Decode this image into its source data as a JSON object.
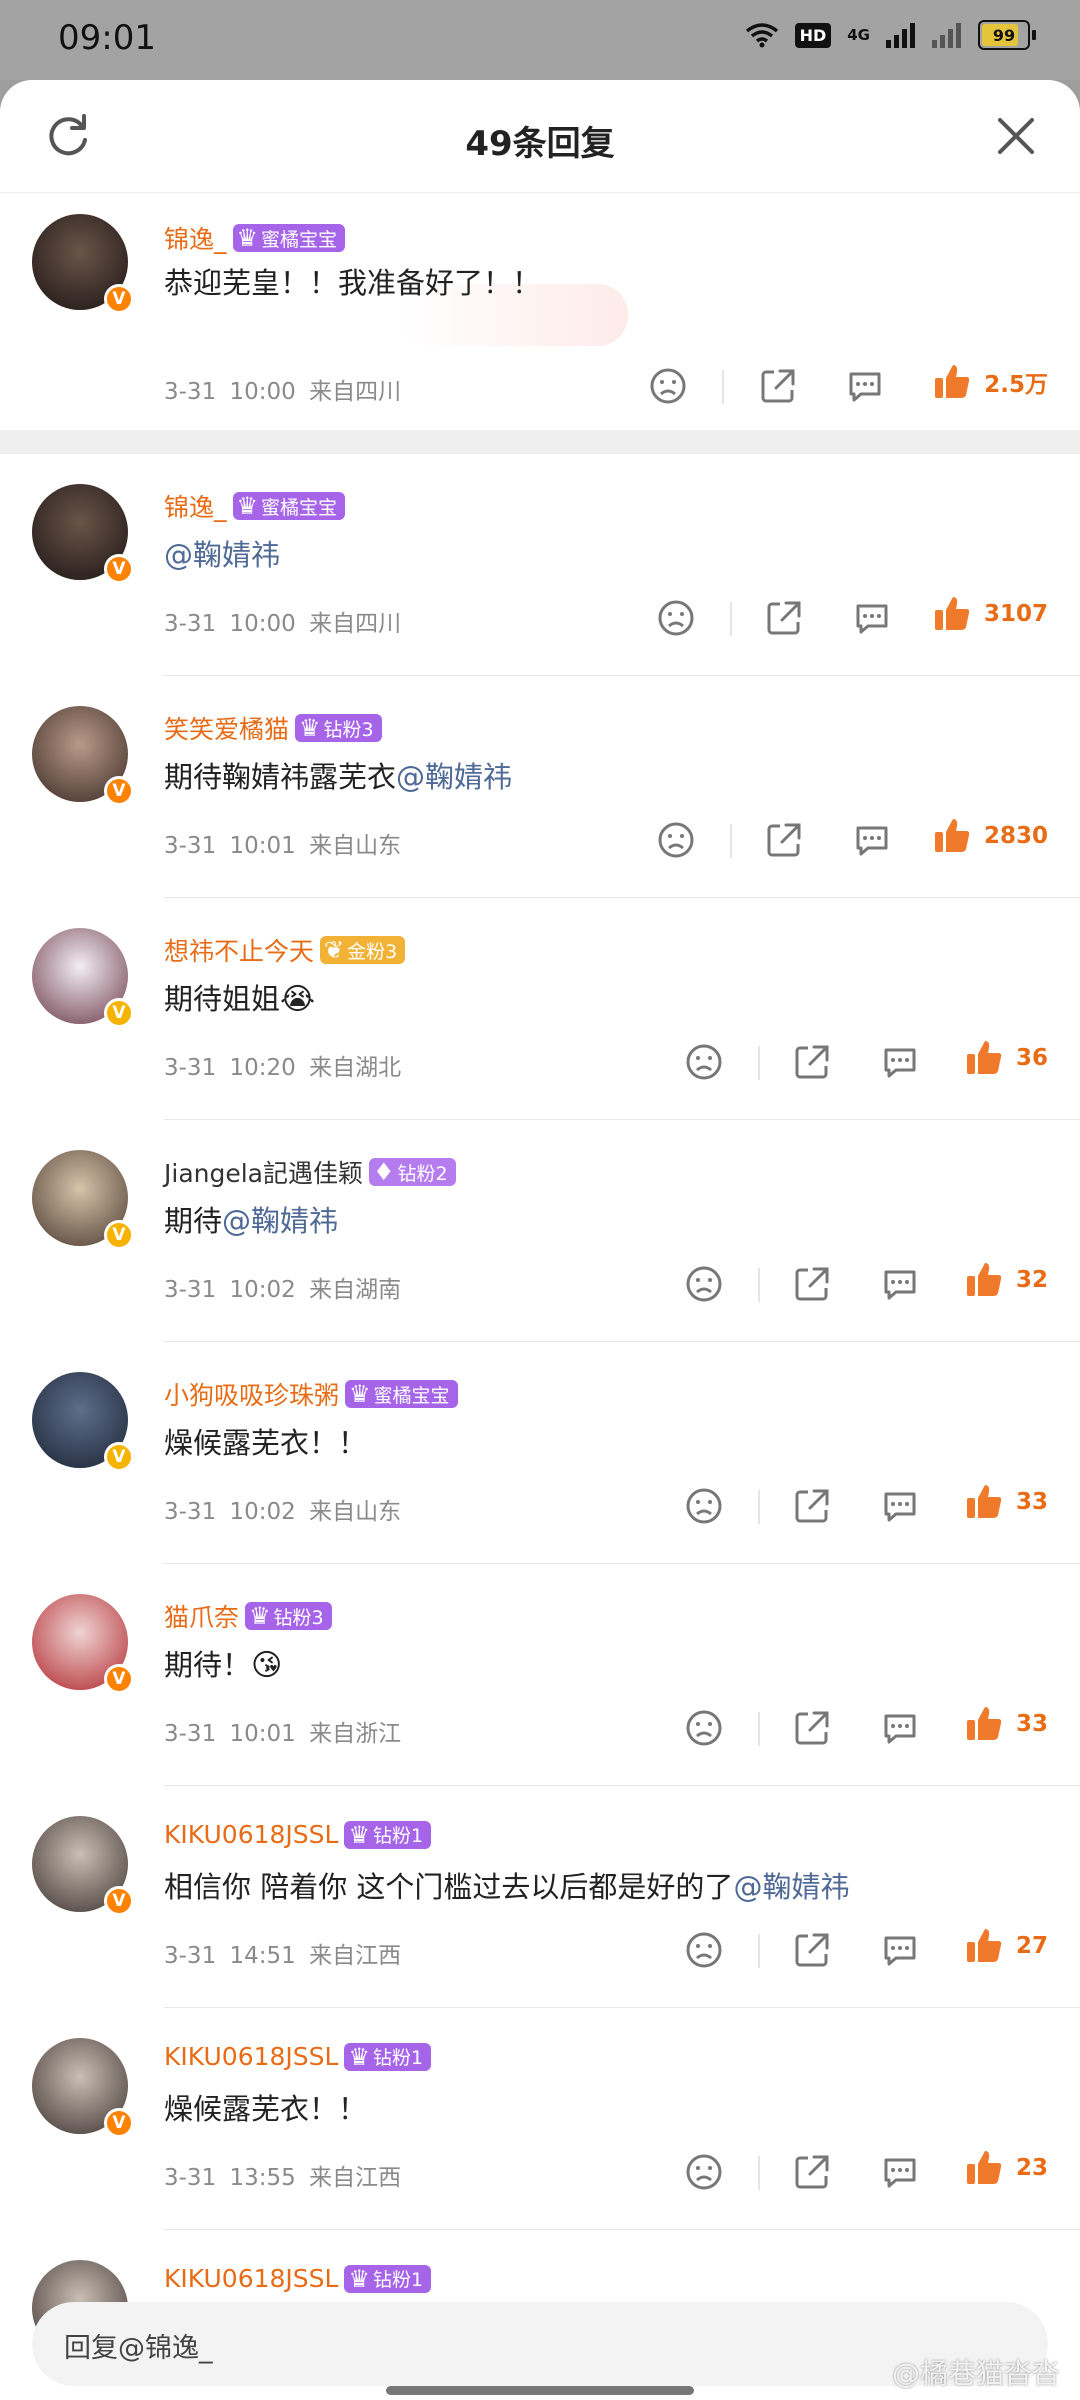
{
  "status": {
    "time": "09:01",
    "hd": "HD",
    "net": "4G",
    "battery": "99"
  },
  "header": {
    "title": "49条回复"
  },
  "colors": {
    "accent": "#e86c16",
    "mention": "#4f6a96",
    "meta": "#8a8a8a"
  },
  "top_comment": {
    "name": "锦逸_",
    "badge": "蜜橘宝宝",
    "text": "恭迎芜皇！！我准备好了！！",
    "date": "3-31",
    "time": "10:00",
    "location": "来自四川",
    "likes": "2.5万"
  },
  "replies": [
    {
      "name": "锦逸_",
      "badge": "蜜橘宝宝",
      "text": "",
      "mention": "@鞠婧祎",
      "date": "3-31",
      "time": "10:00",
      "location": "来自四川",
      "likes": "3107"
    },
    {
      "name": "笑笑爱橘猫",
      "badge": "钻粉3",
      "text": "期待鞠婧祎露芜衣",
      "mention": "@鞠婧祎",
      "date": "3-31",
      "time": "10:01",
      "location": "来自山东",
      "likes": "2830"
    },
    {
      "name": "想祎不止今天",
      "badge": "金粉3",
      "text": "期待姐姐",
      "emoji": "😭",
      "date": "3-31",
      "time": "10:20",
      "location": "来自湖北",
      "likes": "36"
    },
    {
      "name": "Jiangela記遇佳颖",
      "badge": "钻粉2",
      "text": "期待",
      "mention": "@鞠婧祎",
      "date": "3-31",
      "time": "10:02",
      "location": "来自湖南",
      "likes": "32"
    },
    {
      "name": "小狗吸吸珍珠粥",
      "badge": "蜜橘宝宝",
      "text": "燥候露芜衣！！",
      "date": "3-31",
      "time": "10:02",
      "location": "来自山东",
      "likes": "33"
    },
    {
      "name": "猫爪奈",
      "badge": "钻粉3",
      "text": "期待！",
      "emoji": "😘",
      "date": "3-31",
      "time": "10:01",
      "location": "来自浙江",
      "likes": "33"
    },
    {
      "name": "KIKU0618JSSL",
      "badge": "钻粉1",
      "text": "相信你  陪着你  这个门槛过去以后都是好的了",
      "mention": "@鞠婧祎",
      "date": "3-31",
      "time": "14:51",
      "location": "来自江西",
      "likes": "27"
    },
    {
      "name": "KIKU0618JSSL",
      "badge": "钻粉1",
      "text": "燥候露芜衣！！",
      "date": "3-31",
      "time": "13:55",
      "location": "来自江西",
      "likes": "23"
    },
    {
      "name": "KIKU0618JSSL",
      "badge": "钻粉1"
    }
  ],
  "reply_input": {
    "placeholder": "回复@锦逸_"
  },
  "watermark": "@橘巷猫沓沓"
}
